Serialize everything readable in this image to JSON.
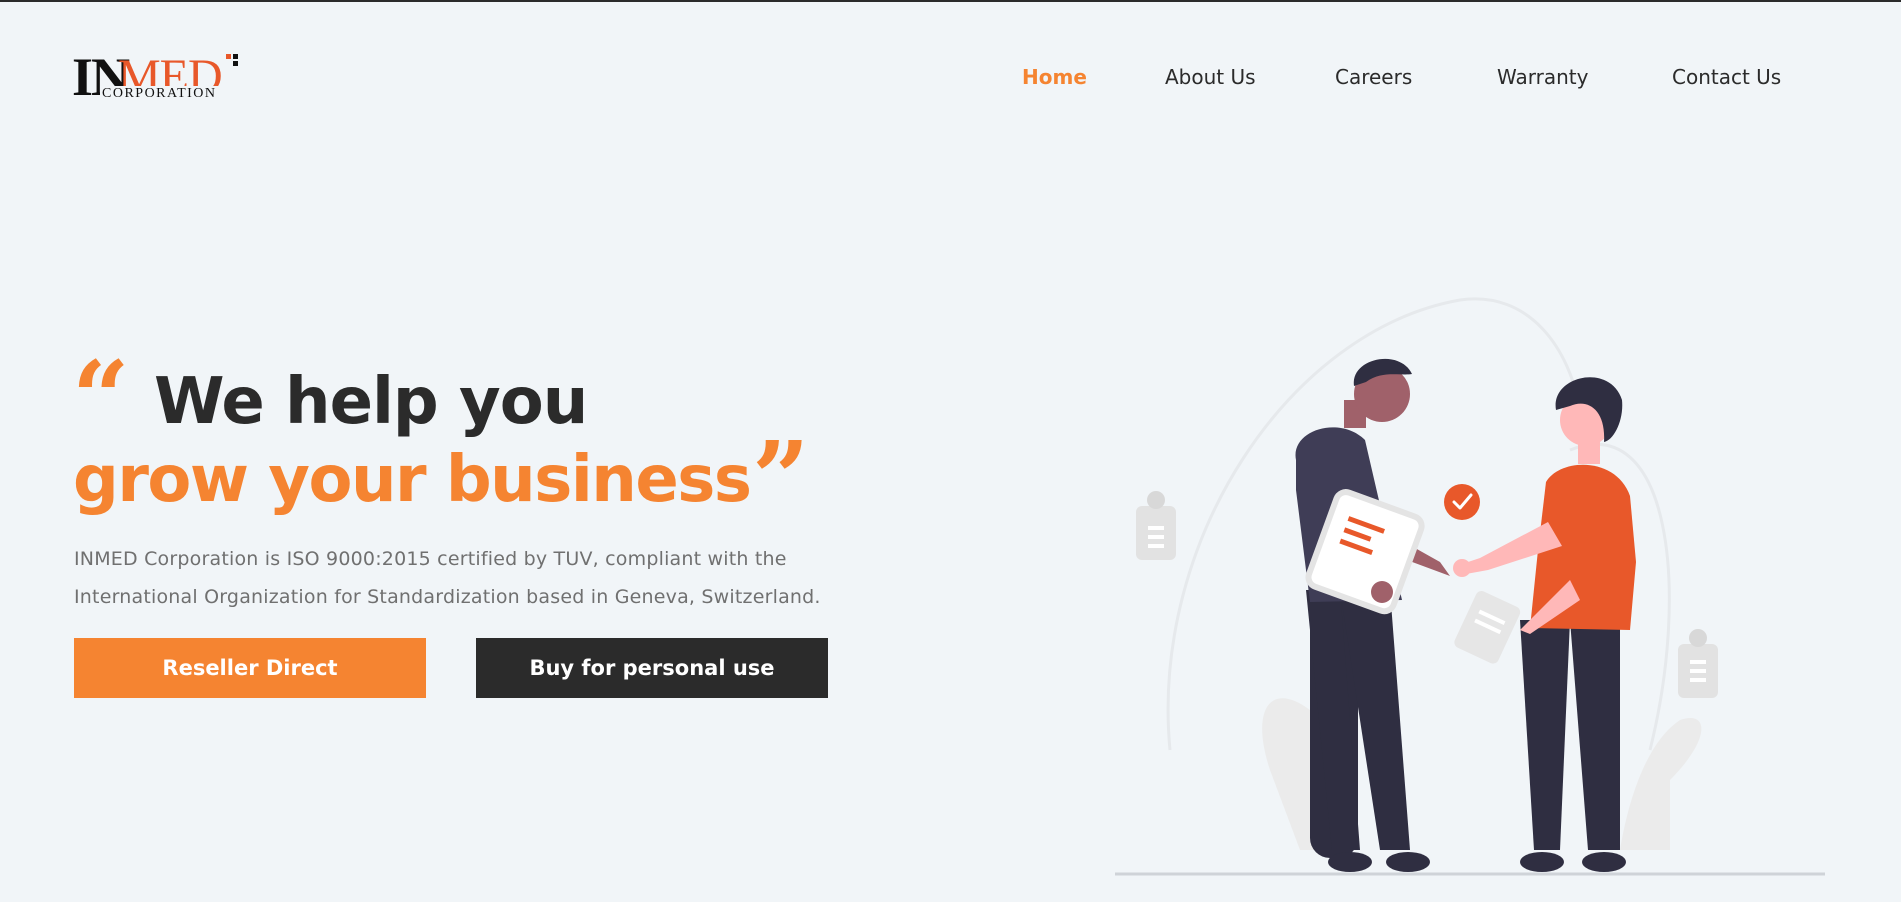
{
  "logo": {
    "in": "IN",
    "med": "MED",
    "corporation": "CORPORATION",
    "colors": {
      "dark": "#111111",
      "accent": "#e8582a"
    }
  },
  "nav": {
    "items": [
      {
        "label": "Home",
        "active": true
      },
      {
        "label": "About Us",
        "active": false
      },
      {
        "label": "Careers",
        "active": false
      },
      {
        "label": "Warranty",
        "active": false
      },
      {
        "label": "Contact Us",
        "active": false
      }
    ]
  },
  "hero": {
    "quote_open": "“",
    "quote_close": "”",
    "title_line1": "We help you",
    "title_line2": "grow your business",
    "description_line1": "INMED Corporation is ISO 9000:2015 certified by TUV, compliant with the",
    "description_line2": "International Organization for Standardization based in Geneva, Switzerland.",
    "buttons": {
      "reseller": "Reseller Direct",
      "personal": "Buy for personal use"
    }
  },
  "illustration": {
    "icon": "handshake-illustration",
    "accent": "#e8582a"
  },
  "colors": {
    "accent": "#f58431",
    "dark": "#2b2b2b",
    "background": "#f1f5f8",
    "text_muted": "#707070"
  }
}
